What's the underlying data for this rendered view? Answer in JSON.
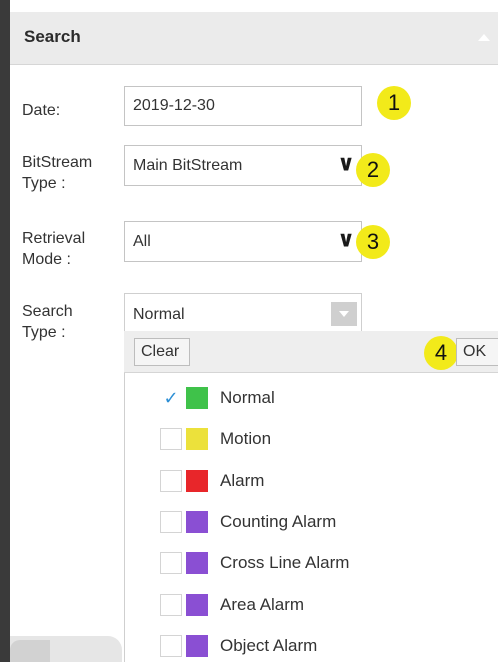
{
  "header": {
    "title": "Search"
  },
  "form": {
    "date": {
      "label": "Date:",
      "value": "2019-12-30",
      "badge": "1"
    },
    "bitstream": {
      "label": "BitStream\nType :",
      "value": "Main BitStream",
      "badge": "2"
    },
    "retrieval": {
      "label": "Retrieval\nMode :",
      "value": "All",
      "badge": "3"
    },
    "search_type": {
      "label": "Search\nType :",
      "value": "Normal"
    }
  },
  "dropdown": {
    "clear_label": "Clear",
    "ok_label": "OK",
    "badge": "4",
    "options": [
      {
        "label": "Normal",
        "color": "#3fc24a",
        "checked": true
      },
      {
        "label": "Motion",
        "color": "#ece13b",
        "checked": false
      },
      {
        "label": "Alarm",
        "color": "#e8262a",
        "checked": false
      },
      {
        "label": "Counting Alarm",
        "color": "#8a4fd3",
        "checked": false
      },
      {
        "label": "Cross Line Alarm",
        "color": "#8a4fd3",
        "checked": false
      },
      {
        "label": "Area Alarm",
        "color": "#8a4fd3",
        "checked": false
      },
      {
        "label": "Object Alarm",
        "color": "#8a4fd3",
        "checked": false
      }
    ]
  },
  "icons": {
    "check": "check-icon",
    "select_arrow": "chevron-down-icon",
    "collapse": "caret-up-icon"
  }
}
